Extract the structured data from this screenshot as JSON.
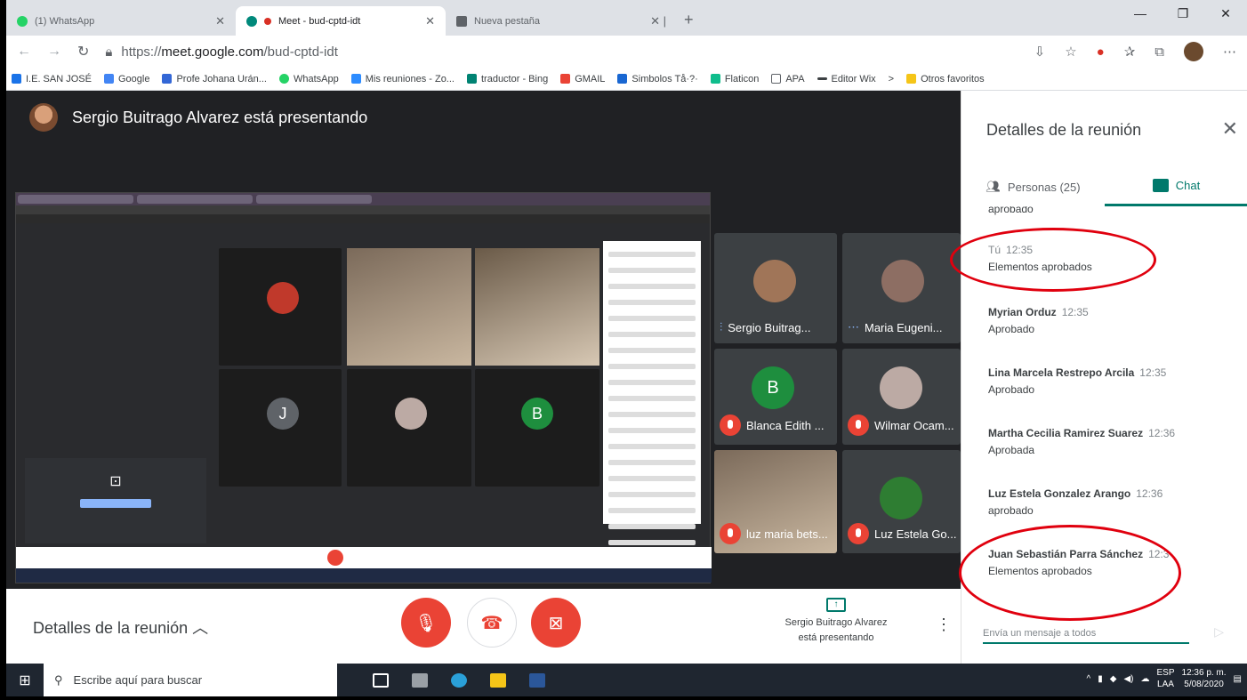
{
  "browser": {
    "tabs": [
      {
        "label": "(1) WhatsApp",
        "color": "#25d366"
      },
      {
        "label": "Meet - bud-cptd-idt",
        "color": "#00897b"
      },
      {
        "label": "Nueva pestaña",
        "color": "#5f6368"
      }
    ],
    "url_prefix": "https://",
    "url_host": "meet.google.com",
    "url_path": "/bud-cptd-idt",
    "bookmarks": [
      "I.E. SAN JOSÉ",
      "Google",
      "Profe Johana Urán...",
      "WhatsApp",
      "Mis reuniones - Zo...",
      "traductor - Bing",
      "GMAIL",
      "Simbolos Tå·?·",
      "Flaticon",
      "APA",
      "Editor Wix",
      "Otros favoritos"
    ]
  },
  "meet": {
    "presenter_banner": "Sergio Buitrago Alvarez está presentando",
    "tiles": [
      {
        "name": "Sergio Buitrag..."
      },
      {
        "name": "Maria Eugeni..."
      },
      {
        "name": "Blanca Edith ...",
        "initial": "B"
      },
      {
        "name": "Wilmar Ocam..."
      },
      {
        "name": "luz maria bets..."
      },
      {
        "name": "Luz Estela Go..."
      }
    ],
    "shared_initials": [
      "J",
      "B"
    ],
    "details_label": "Detalles de la reunión",
    "presenting_label_1": "Sergio Buitrago Alvarez",
    "presenting_label_2": "está presentando"
  },
  "panel": {
    "title": "Detalles de la reunión",
    "people_tab": "Personas (25)",
    "chat_tab": "Chat",
    "messages": [
      {
        "who": "",
        "time": "",
        "text": "aprobado"
      },
      {
        "who": "Tú",
        "time": "12:35",
        "text": "Elementos aprobados"
      },
      {
        "who": "Myrian Orduz",
        "time": "12:35",
        "text": "Aprobado"
      },
      {
        "who": "Lina Marcela Restrepo Arcila",
        "time": "12:35",
        "text": "Aprobado"
      },
      {
        "who": "Martha Cecilia Ramirez Suarez",
        "time": "12:36",
        "text": "Aprobada"
      },
      {
        "who": "Luz Estela Gonzalez Arango",
        "time": "12:36",
        "text": "aprobado"
      },
      {
        "who": "Juan Sebastián Parra Sánchez",
        "time": "12:3",
        "text": "Elementos aprobados"
      }
    ],
    "compose_placeholder": "Envía un mensaje a todos"
  },
  "taskbar": {
    "search_placeholder": "Escribe aquí para buscar",
    "lang_1": "ESP",
    "lang_2": "LAA",
    "time": "12:36 p. m.",
    "date": "5/08/2020"
  },
  "colors": {
    "accent": "#00796b",
    "danger": "#ea4335",
    "annotation": "#e0000e"
  }
}
